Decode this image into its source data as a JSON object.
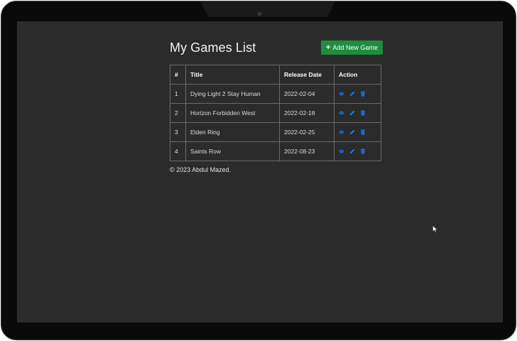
{
  "app": {
    "title": "My Games List",
    "add_button_label": "Add New Game"
  },
  "table": {
    "headers": [
      "#",
      "Title",
      "Release Date",
      "Action"
    ],
    "rows": [
      {
        "num": "1",
        "title": "Dying Light 2 Stay Human",
        "date": "2022-02-04"
      },
      {
        "num": "2",
        "title": "Horizon Forbidden West",
        "date": "2022-02-18"
      },
      {
        "num": "3",
        "title": "Elden Ring",
        "date": "2022-02-25"
      },
      {
        "num": "4",
        "title": "Saints Row",
        "date": "2022-08-23"
      }
    ],
    "action_icons": [
      "eye-icon",
      "pencil-icon",
      "trash-icon"
    ]
  },
  "footer": {
    "text": "© 2023 Abdul Mazed."
  },
  "colors": {
    "background": "#2b2b2b",
    "button_green": "#1e8e3e",
    "icon_blue": "#1e7bff"
  }
}
